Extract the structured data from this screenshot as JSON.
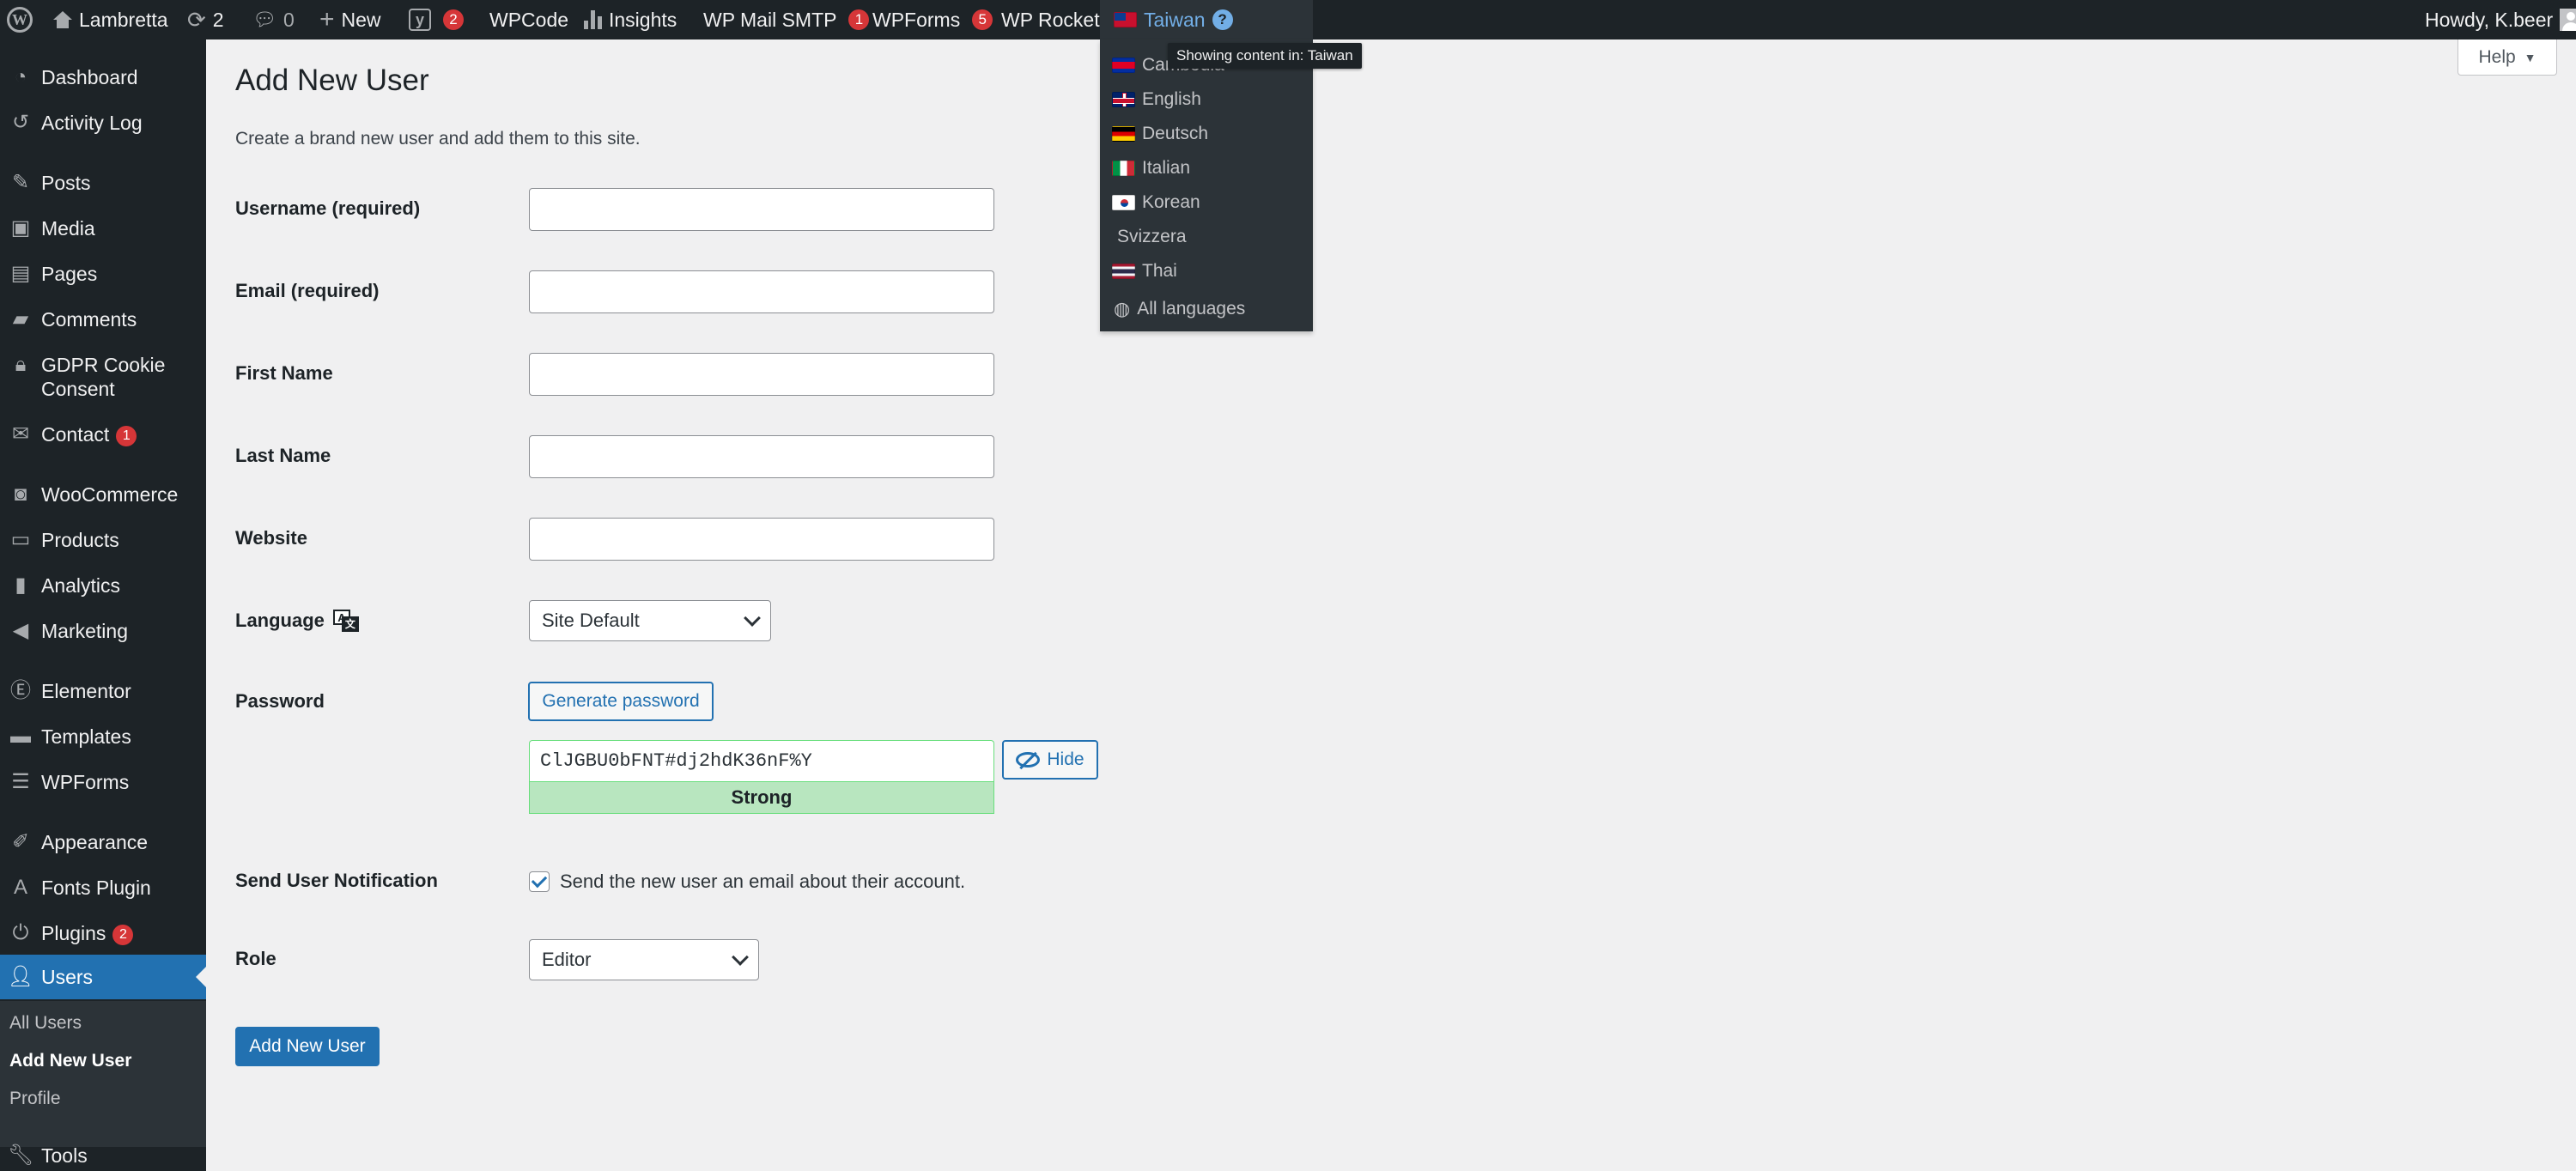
{
  "admin_bar": {
    "site_name": "Lambretta",
    "updates_count": "2",
    "comments_count": "0",
    "new_label": "New",
    "yoast_count": "2",
    "wpcode_label": "WPCode",
    "insights_label": "Insights",
    "mail_smtp_label": "WP Mail SMTP",
    "mail_smtp_count": "1",
    "wpforms_label": "WPForms",
    "wpforms_count": "5",
    "wp_rocket_label": "WP Rocket",
    "language_label": "Taiwan",
    "help_glyph": "?",
    "greeting": "Howdy, K.beer"
  },
  "language_menu": {
    "tooltip": "Showing content in: Taiwan",
    "items": [
      {
        "label": "Cambodia",
        "flag": "flag-kh"
      },
      {
        "label": "English",
        "flag": "flag-gb"
      },
      {
        "label": "Deutsch",
        "flag": "flag-de"
      },
      {
        "label": "Italian",
        "flag": "flag-it"
      },
      {
        "label": "Korean",
        "flag": "flag-kr"
      },
      {
        "label": "Svizzera",
        "flag": ""
      },
      {
        "label": "Thai",
        "flag": "flag-th"
      }
    ],
    "all_languages": "All languages"
  },
  "sidebar": {
    "items": [
      {
        "label": "Dashboard",
        "icon": "dashboard-icon"
      },
      {
        "label": "Activity Log",
        "icon": "activity-log-icon"
      },
      {
        "label": "Posts",
        "icon": "pin-icon"
      },
      {
        "label": "Media",
        "icon": "media-icon"
      },
      {
        "label": "Pages",
        "icon": "pages-icon"
      },
      {
        "label": "Comments",
        "icon": "comments-icon"
      },
      {
        "label": "GDPR Cookie Consent",
        "icon": "lock-icon"
      },
      {
        "label": "Contact",
        "icon": "mail-icon",
        "badge": "1"
      },
      {
        "label": "WooCommerce",
        "icon": "woocommerce-icon"
      },
      {
        "label": "Products",
        "icon": "archive-icon"
      },
      {
        "label": "Analytics",
        "icon": "analytics-icon"
      },
      {
        "label": "Marketing",
        "icon": "megaphone-icon"
      },
      {
        "label": "Elementor",
        "icon": "elementor-icon"
      },
      {
        "label": "Templates",
        "icon": "folder-icon"
      },
      {
        "label": "WPForms",
        "icon": "wpforms-icon"
      },
      {
        "label": "Appearance",
        "icon": "brush-icon"
      },
      {
        "label": "Fonts Plugin",
        "icon": "font-icon"
      },
      {
        "label": "Plugins",
        "icon": "plug-icon",
        "badge": "2"
      },
      {
        "label": "Users",
        "icon": "user-icon"
      },
      {
        "label": "Tools",
        "icon": "wrench-icon"
      }
    ],
    "submenu": [
      "All Users",
      "Add New User",
      "Profile"
    ]
  },
  "help_tab": "Help",
  "page": {
    "title": "Add New User",
    "description": "Create a brand new user and add them to this site."
  },
  "form": {
    "username_label": "Username (required)",
    "email_label": "Email (required)",
    "first_name_label": "First Name",
    "last_name_label": "Last Name",
    "website_label": "Website",
    "language_label": "Language",
    "language_value": "Site Default",
    "password_label": "Password",
    "generate_password": "Generate password",
    "password_value": "ClJGBU0bFNT#dj2hdK36nF%Y",
    "hide_label": "Hide",
    "strength": "Strong",
    "notification_label": "Send User Notification",
    "notification_text": "Send the new user an email about their account.",
    "notification_checked": true,
    "role_label": "Role",
    "role_value": "Editor",
    "submit": "Add New User"
  },
  "colors": {
    "admin_bar_bg": "#1d2327",
    "accent": "#2271b1",
    "badge": "#d63638",
    "strength_bg": "#b8e6bf"
  }
}
